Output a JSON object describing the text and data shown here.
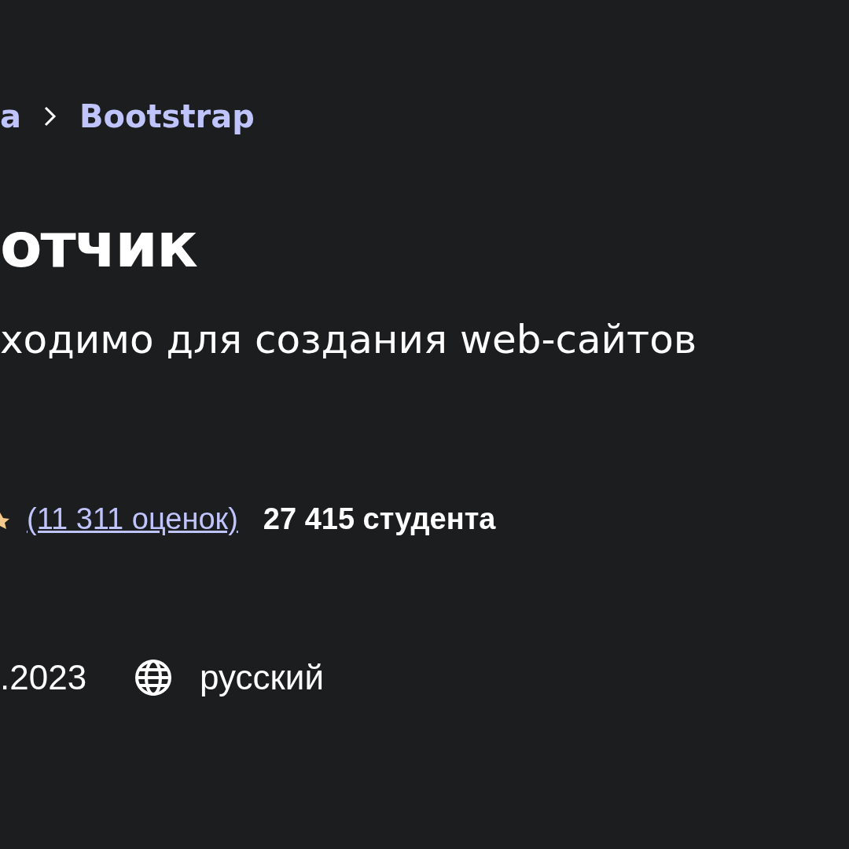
{
  "breadcrumb": {
    "items": [
      "а",
      "Bootstrap"
    ]
  },
  "title": "отчик",
  "subtitle": "ходимо для создания web-сайтов",
  "rating": {
    "count_link": "(11 311 оценок)",
    "students": "27 415 студента"
  },
  "meta": {
    "date": ".2023",
    "language": "русский"
  }
}
